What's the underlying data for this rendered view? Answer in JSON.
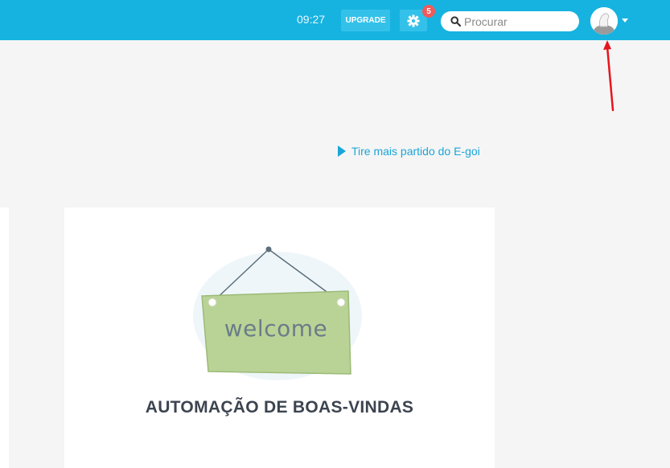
{
  "header": {
    "time": "09:27",
    "upgrade_label": "UPGRADE",
    "settings_badge_count": "5",
    "search": {
      "placeholder": "Procurar",
      "value": ""
    },
    "accent_color": "#17b3e0"
  },
  "main": {
    "tip_link_label": "Tire mais partido do E-goi",
    "card": {
      "sign_text": "welcome",
      "title": "AUTOMAÇÃO DE BOAS-VINDAS"
    }
  },
  "icons": [
    "settings-gear-icon",
    "search-icon",
    "avatar-icon",
    "chevron-down-icon",
    "play-icon",
    "welcome-sign-illustration"
  ],
  "annotation_color": "#e8141c"
}
